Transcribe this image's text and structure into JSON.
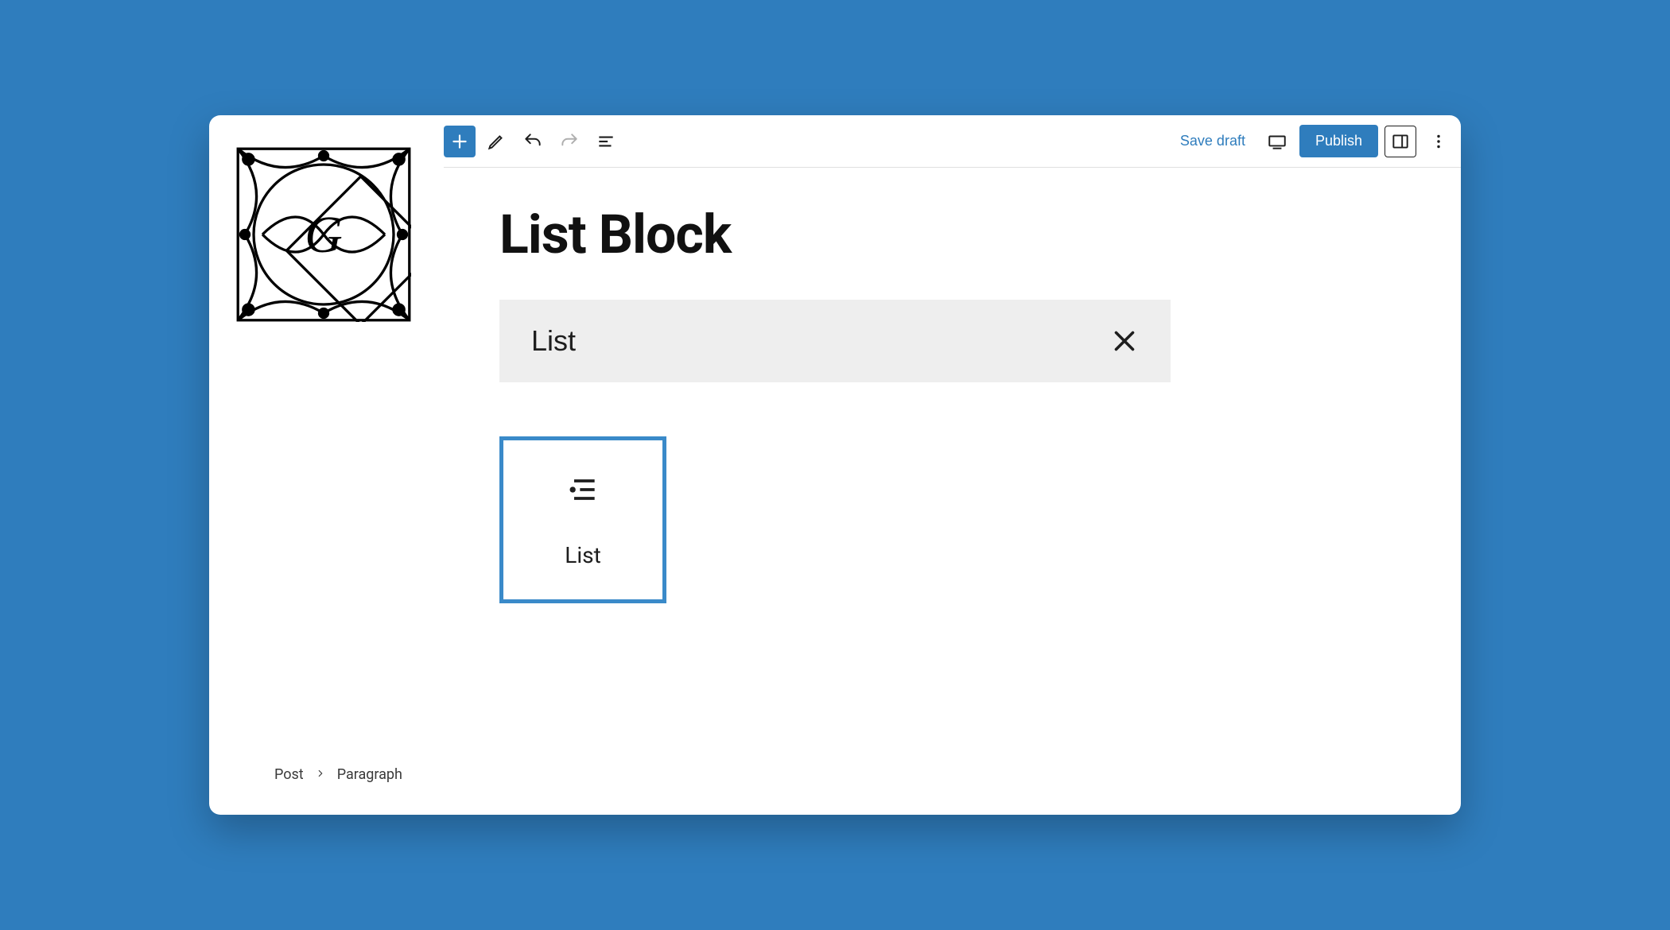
{
  "toolbar": {
    "save_draft": "Save draft",
    "publish": "Publish"
  },
  "page": {
    "title": "List Block"
  },
  "search": {
    "value": "List"
  },
  "block_result": {
    "label": "List"
  },
  "breadcrumb": {
    "root": "Post",
    "current": "Paragraph"
  },
  "colors": {
    "accent": "#2f7dbd"
  }
}
